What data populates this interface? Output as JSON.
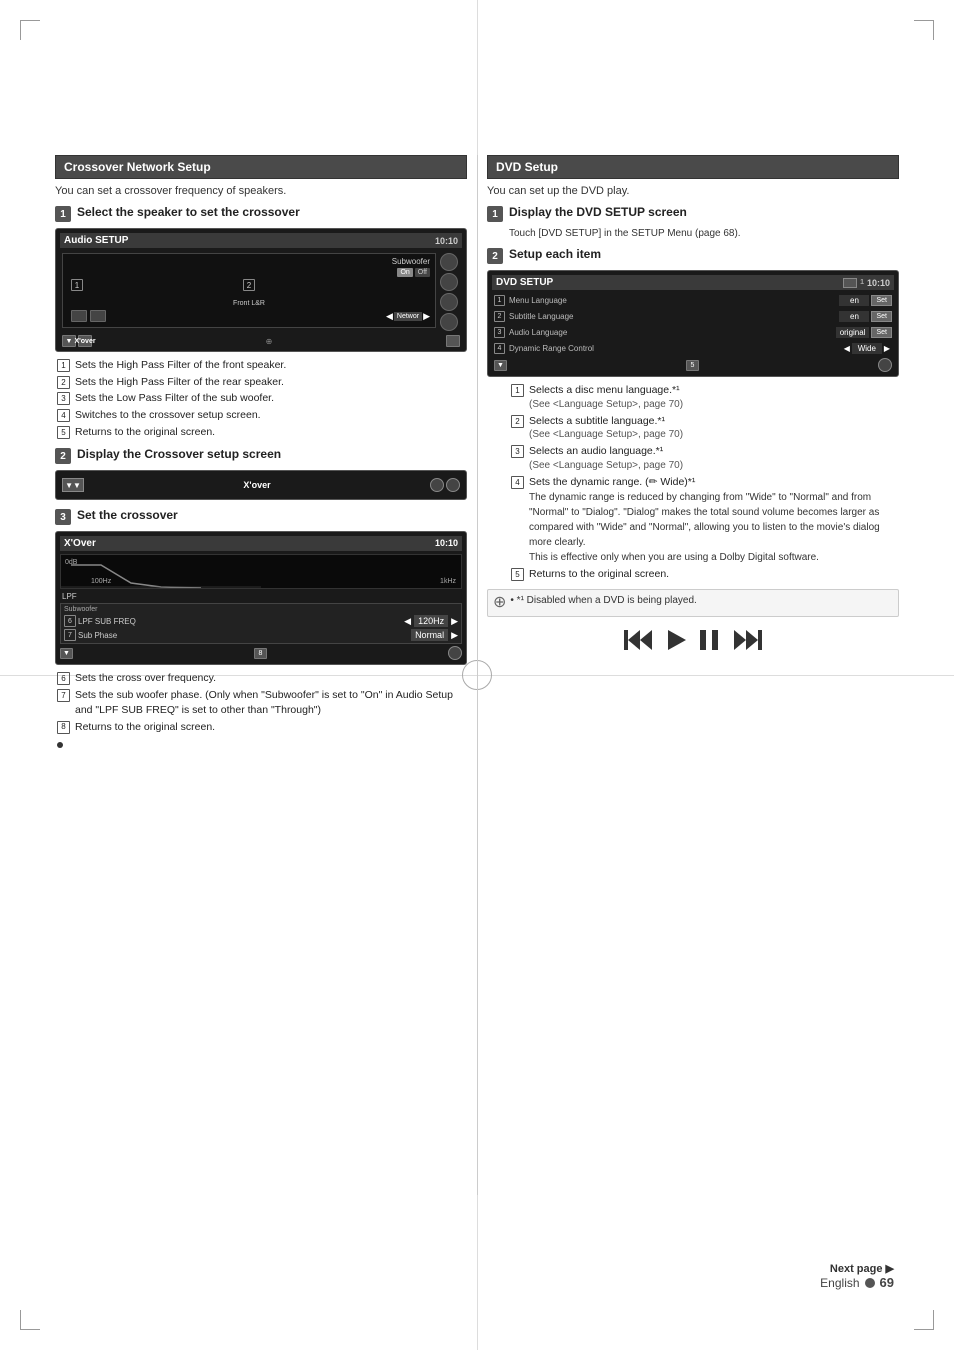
{
  "page": {
    "language": "English",
    "page_number": "69",
    "next_page_label": "Next page ▶"
  },
  "left_section": {
    "title": "Crossover Network Setup",
    "intro": "You can set a crossover frequency of speakers.",
    "steps": [
      {
        "num": "1",
        "title": "Select the speaker to set the crossover",
        "screen": {
          "title": "Audio SETUP",
          "time": "10:10",
          "subwoofer_label": "Subwoofer",
          "front_label": "Front L&R",
          "on_label": "On",
          "off_label": "Off"
        }
      },
      {
        "num": "2",
        "title": "Display the Crossover setup screen"
      },
      {
        "num": "3",
        "title": "Set the crossover",
        "screen": {
          "title": "X'Over",
          "time": "10:10",
          "lpf_label": "LPF",
          "subwoofer_label": "Subwoofer",
          "lpf_freq_label": "LPF SUB FREQ",
          "freq_value": "120Hz",
          "sub_phase_label": "Sub Phase",
          "phase_value": "Normal",
          "freq_axis_0": "0dB",
          "freq_axis_100": "100Hz",
          "freq_axis_1k": "1kHz"
        }
      }
    ],
    "num_items_step1": [
      {
        "num": "1",
        "text": "Sets the High Pass Filter of the front speaker."
      },
      {
        "num": "2",
        "text": "Sets the High Pass Filter of the rear speaker."
      },
      {
        "num": "3",
        "text": "Sets the Low Pass Filter of the sub woofer."
      },
      {
        "num": "4",
        "text": "Switches to the crossover setup screen."
      },
      {
        "num": "5",
        "text": "Returns to the original screen."
      }
    ],
    "num_items_step3": [
      {
        "num": "6",
        "text": "Sets the cross over frequency."
      },
      {
        "num": "7",
        "text": "Sets the sub woofer phase. (Only when \"Subwoofer\" is set to \"On\" in Audio Setup and \"LPF SUB FREQ\" is set to other than \"Through\")"
      },
      {
        "num": "8",
        "text": "Returns to the original screen."
      }
    ]
  },
  "right_section": {
    "title": "DVD Setup",
    "intro": "You can set up the DVD play.",
    "steps": [
      {
        "num": "1",
        "title": "Display the DVD SETUP screen",
        "description": "Touch [DVD SETUP] in the SETUP Menu (page 68)."
      },
      {
        "num": "2",
        "title": "Setup each item",
        "screen": {
          "title": "DVD SETUP",
          "time": "10:10",
          "rows": [
            {
              "num": "1",
              "label": "Menu Language",
              "value": "en",
              "btn": "Set"
            },
            {
              "num": "2",
              "label": "Subtitle Language",
              "value": "en",
              "btn": "Set"
            },
            {
              "num": "3",
              "label": "Audio Language",
              "value": "original",
              "btn": "Set"
            },
            {
              "num": "4",
              "label": "Dynamic Range Control",
              "value": "Wide",
              "has_arrows": true
            }
          ]
        }
      }
    ],
    "num_items": [
      {
        "num": "1",
        "text": "Selects a disc menu language.*¹",
        "sub": "(See <Language Setup>, page 70)"
      },
      {
        "num": "2",
        "text": "Selects a subtitle language.*¹",
        "sub": "(See <Language Setup>, page 70)"
      },
      {
        "num": "3",
        "text": "Selects an audio language.*¹",
        "sub": "(See <Language Setup>, page 70)"
      },
      {
        "num": "4",
        "text": "Sets the dynamic range. (✏ Wide)*¹",
        "sub": "The dynamic range is reduced by changing from \"Wide\" to \"Normal\" and from \"Normal\" to \"Dialog\". \"Dialog\" makes the total sound volume becomes larger as compared with \"Wide\" and \"Normal\", allowing you to listen to the movie's dialog more clearly.\nThis is effective only when you are using a Dolby Digital software."
      },
      {
        "num": "5",
        "text": "Returns to the original screen."
      }
    ],
    "note": "• *¹ Disabled when a DVD is being played."
  }
}
